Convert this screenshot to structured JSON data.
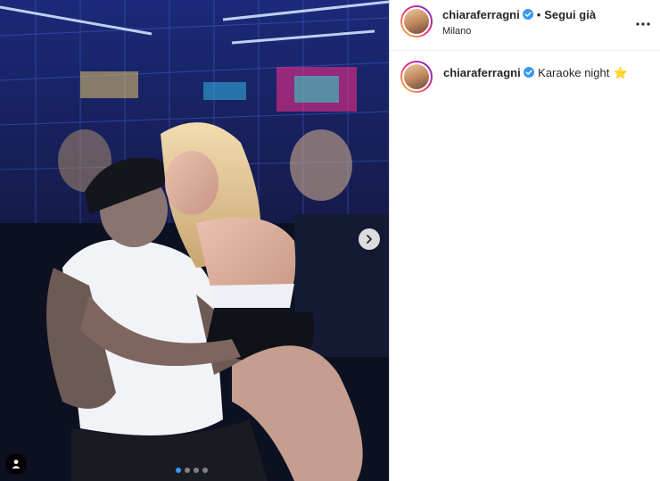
{
  "post": {
    "username": "chiaraferragni",
    "follow_status": "Segui già",
    "location": "Milano",
    "more_label": "•••",
    "caption": {
      "username": "chiaraferragni",
      "text": "Karaoke night",
      "emoji": "⭐"
    }
  },
  "carousel": {
    "total_slides": 4,
    "current_slide": 1
  },
  "colors": {
    "verified": "#3897f0",
    "active_dot": "#3797f0",
    "text": "#262626"
  },
  "icons": {
    "next": "chevron-right-icon",
    "tag": "user-tag-icon",
    "verified": "verified-badge-icon",
    "more": "more-options-icon"
  }
}
